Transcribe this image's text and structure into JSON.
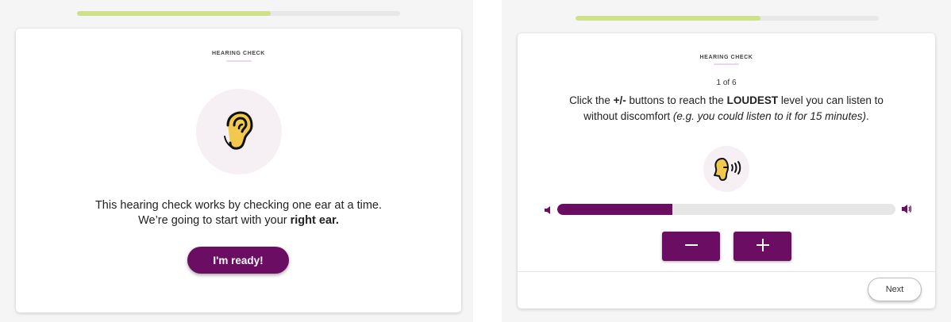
{
  "left": {
    "progress": 0.6,
    "section_title": "HEARING CHECK",
    "icon": "ear-icon",
    "message_line1": "This hearing check works by checking one ear at a time.",
    "message_line2_prefix": "We’re going to start with your ",
    "message_line2_bold": "right ear.",
    "ready_label": "I'm ready!"
  },
  "right": {
    "progress": 0.61,
    "section_title": "HEARING CHECK",
    "step": "1 of 6",
    "instruction": {
      "part1": "Click the ",
      "part2": "+/-",
      "part3": " buttons to reach the ",
      "part4": "LOUDEST",
      "part5": " level you can listen to",
      "line2": "without discomfort ",
      "line2_italic": "(e.g. you could listen to it for 15 minutes)",
      "line2_end": "."
    },
    "icon": "speaking-head-icon",
    "volume_level": 0.34,
    "minus_icon": "minus-icon",
    "plus_icon": "plus-icon",
    "next_label": "Next"
  },
  "colors": {
    "accent": "#6b0d63",
    "progress": "#cfe08a",
    "icon_gold": "#f2c94c",
    "circle_bg": "#f6f0f5"
  }
}
